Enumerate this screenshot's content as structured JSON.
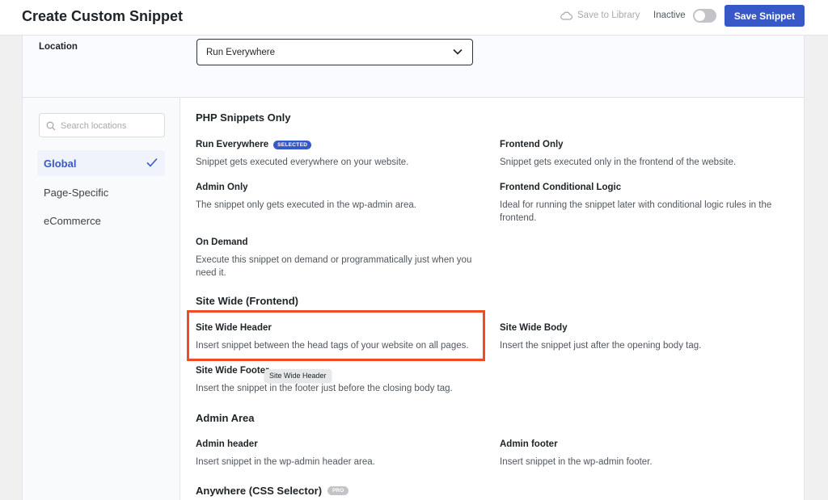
{
  "header": {
    "title": "Create Custom Snippet",
    "save_to_library": "Save to Library",
    "status_label": "Inactive",
    "save_button": "Save Snippet"
  },
  "location": {
    "label": "Location",
    "selected": "Run Everywhere"
  },
  "search": {
    "placeholder": "Search locations"
  },
  "sidebar": {
    "items": [
      {
        "label": "Global"
      },
      {
        "label": "Page-Specific"
      },
      {
        "label": "eCommerce"
      }
    ]
  },
  "sections": [
    {
      "title": "PHP Snippets Only",
      "options": [
        {
          "title": "Run Everywhere",
          "badge": "SELECTED",
          "desc": "Snippet gets executed everywhere on your website."
        },
        {
          "title": "Frontend Only",
          "desc": "Snippet gets executed only in the frontend of the website."
        },
        {
          "title": "Admin Only",
          "desc": "The snippet only gets executed in the wp-admin area."
        },
        {
          "title": "Frontend Conditional Logic",
          "desc": "Ideal for running the snippet later with conditional logic rules in the frontend."
        },
        {
          "title": "On Demand",
          "desc": "Execute this snippet on demand or programmatically just when you need it."
        }
      ]
    },
    {
      "title": "Site Wide (Frontend)",
      "options": [
        {
          "title": "Site Wide Header",
          "desc": "Insert snippet between the head tags of your website on all pages."
        },
        {
          "title": "Site Wide Body",
          "desc": "Insert the snippet just after the opening body tag."
        },
        {
          "title": "Site Wide Footer",
          "desc": "Insert the snippet in the footer just before the closing body tag."
        }
      ]
    },
    {
      "title": "Admin Area",
      "options": [
        {
          "title": "Admin header",
          "desc": "Insert snippet in the wp-admin header area."
        },
        {
          "title": "Admin footer",
          "desc": "Insert snippet in the wp-admin footer."
        }
      ]
    },
    {
      "title": "Anywhere (CSS Selector)",
      "badge": "PRO"
    }
  ],
  "tooltip": "Site Wide Header",
  "colors": {
    "accent": "#3858c8",
    "highlight": "#f04b23"
  }
}
